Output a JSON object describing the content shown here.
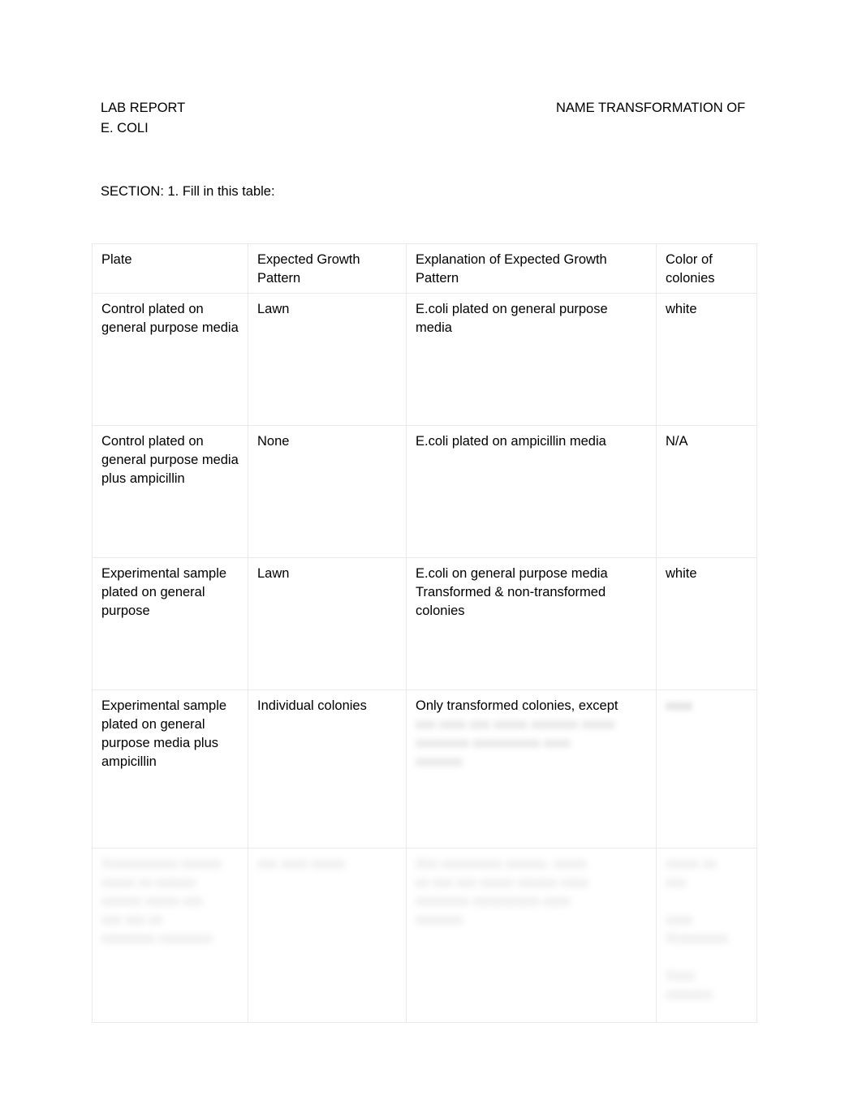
{
  "document": {
    "header": {
      "left_label": "LAB REPORT",
      "right_label": "NAME   TRANSFORMATION OF",
      "second_line": "E. COLI"
    },
    "section_prompt": "SECTION: 1. Fill in this table:"
  },
  "table": {
    "columns": [
      "Plate",
      "Expected Growth Pattern",
      "Explanation of Expected Growth Pattern",
      "Color of colonies"
    ],
    "rows": [
      {
        "plate": "Control plated on general purpose media",
        "expected_growth_pattern": "Lawn",
        "explanation": "E.coli plated on general purpose media",
        "color_of_colonies": "white",
        "redacted": false
      },
      {
        "plate": "Control plated on general purpose media plus ampicillin",
        "expected_growth_pattern": "None",
        "explanation": "E.coli plated on ampicillin media",
        "color_of_colonies": "N/A",
        "redacted": false
      },
      {
        "plate": "Experimental sample plated on general purpose",
        "expected_growth_pattern": "Lawn",
        "explanation": "E.coli on general purpose media Transformed & non-transformed colonies",
        "color_of_colonies": "white",
        "redacted": false
      },
      {
        "plate": "Experimental sample plated on general purpose media plus ampicillin",
        "expected_growth_pattern": "Individual colonies",
        "explanation": "Only transformed colonies, except",
        "explanation_redacted": "xxx xxxx xxx xxxxx xxxxxxx xxxxx\nxxxxxxxx xxxxxxxxxx xxxx\nxxxxxxx",
        "color_of_colonies": "",
        "color_redacted": "xxxx",
        "redacted": true
      },
      {
        "plate_redacted": "Xxxxxxxxxxx xxxxxx\nxxxxx xx xxxxxx\nxxxxxx xxxxx xxx\nxxx xxx xx\nxxxxxxxx xxxxxxxx",
        "expected_growth_pattern_redacted": "xxx xxxx xxxxx",
        "explanation_redacted": "Xxx xxxxxxxxx xxxxxx, xxxxx\nxx xxx xxx xxxxx xxxxxx xxxx\nxxxxxxxx xxxxxxxxxx xxxx\nxxxxxxx",
        "color_redacted": "xxxxx xx\nxxx\n\nxxxx\nXxxxxxxxx\n\nXxxx\nxxxxxxx",
        "redacted": true
      }
    ]
  }
}
